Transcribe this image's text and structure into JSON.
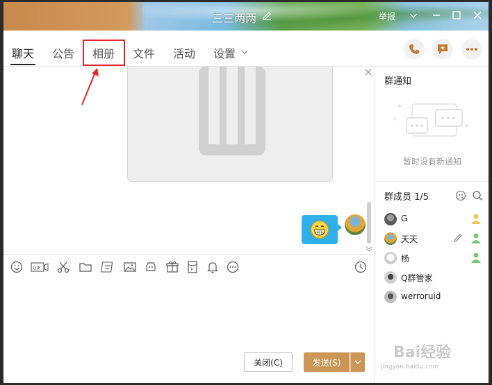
{
  "window": {
    "title": "三三两两",
    "report_label": "举报"
  },
  "tabs": [
    {
      "label": "聊天",
      "active": true
    },
    {
      "label": "公告"
    },
    {
      "label": "相册",
      "highlighted": true
    },
    {
      "label": "文件"
    },
    {
      "label": "活动"
    },
    {
      "label": "设置"
    }
  ],
  "header_actions": [
    "phone-icon",
    "add-chat-icon",
    "more-icon"
  ],
  "chat": {
    "emoji_message": "grinning-face"
  },
  "toolbar": [
    "emoji-icon",
    "gif-icon",
    "scissors-icon",
    "folder-icon",
    "screenshot-edit-icon",
    "image-icon",
    "shake-icon",
    "gift-icon",
    "red-packet-icon",
    "bell-icon",
    "more-circle-icon",
    "history-clock-icon"
  ],
  "buttons": {
    "close_label": "关闭(C)",
    "send_label": "发送(S)"
  },
  "panel": {
    "notice_title": "群通知",
    "notice_empty": "暂时没有新通知",
    "members_title": "群成员 1/5",
    "members": [
      {
        "name": "G",
        "role": "admin"
      },
      {
        "name": "天天",
        "role": "admin",
        "editable": true
      },
      {
        "name": "杨",
        "role": "member"
      },
      {
        "name": "Q群管家",
        "role": "bot"
      },
      {
        "name": "werroruid",
        "role": "bot"
      }
    ]
  },
  "colors": {
    "accent_send": "#cc9656",
    "bubble": "#2fb0ea",
    "highlight_box": "#e4252c"
  },
  "watermark": {
    "text": "Bai经验",
    "url": "jingyan.baidu.com"
  }
}
